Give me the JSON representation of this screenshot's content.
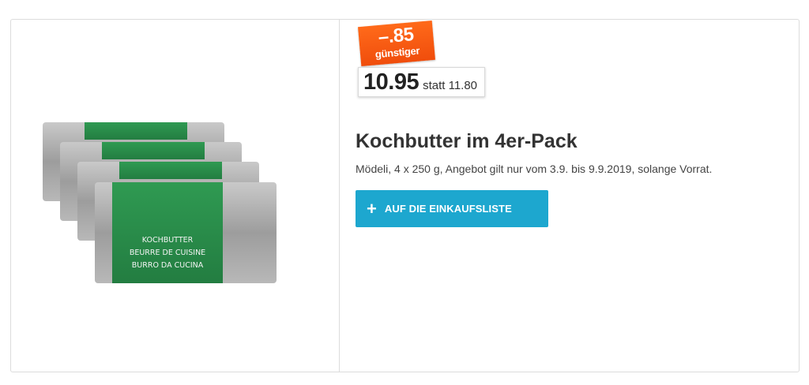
{
  "product": {
    "image_labels": [
      "KOCHBUTTER",
      "BEURRE DE CUISINE",
      "BURRO DA CUCINA"
    ],
    "discount": {
      "amount": "–.85",
      "text": "günstiger"
    },
    "price": {
      "current": "10.95",
      "old": "statt 11.80"
    },
    "title": "Kochbutter im 4er-Pack",
    "description": "Mödeli, 4 x 250 g, Angebot gilt nur vom 3.9. bis 9.9.2019, solange Vorrat.",
    "add_to_list": {
      "icon": "plus-icon",
      "label": "AUF DIE EINKAUFSLISTE"
    }
  },
  "colors": {
    "badge": "#f25a10",
    "button": "#1da7cf",
    "wrapper_green": "#2a8f4a",
    "foil_silver": "#a9a9a9"
  }
}
